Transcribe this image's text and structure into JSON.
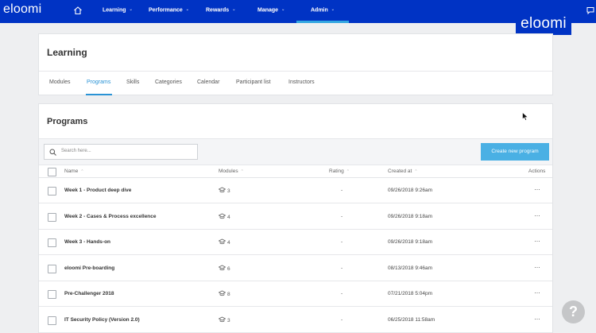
{
  "header": {
    "logo": "eloomi",
    "nav": [
      {
        "label": "Learning"
      },
      {
        "label": "Performance"
      },
      {
        "label": "Rewards"
      },
      {
        "label": "Manage"
      },
      {
        "label": "Admin",
        "active": true
      }
    ],
    "caret": "⌄"
  },
  "brand": {
    "logo": "eloomi"
  },
  "learning": {
    "title": "Learning",
    "tabs": [
      {
        "label": "Modules"
      },
      {
        "label": "Programs",
        "active": true
      },
      {
        "label": "Skills"
      },
      {
        "label": "Categories"
      },
      {
        "label": "Calendar"
      },
      {
        "label": "Participant list"
      },
      {
        "label": "Instructors"
      }
    ]
  },
  "programs": {
    "title": "Programs",
    "search_placeholder": "Search here...",
    "create_label": "Create new program",
    "columns": {
      "name": "Name",
      "modules": "Modules",
      "rating": "Rating",
      "created": "Created at",
      "actions": "Actions"
    },
    "sort_glyph": "⌃",
    "rows": [
      {
        "name": "Week 1 - Product deep dive",
        "modules": "3",
        "rating": "-",
        "created": "09/26/2018 9:26am",
        "actions": "···"
      },
      {
        "name": "Week 2 - Cases & Process excellence",
        "modules": "4",
        "rating": "-",
        "created": "09/26/2018 9:18am",
        "actions": "···"
      },
      {
        "name": "Week 3 - Hands-on",
        "modules": "4",
        "rating": "-",
        "created": "09/26/2018 9:18am",
        "actions": "···"
      },
      {
        "name": "eloomi Pre-boarding",
        "modules": "6",
        "rating": "-",
        "created": "08/13/2018 9:46am",
        "actions": "···"
      },
      {
        "name": "Pre-Challenger 2018",
        "modules": "8",
        "rating": "-",
        "created": "07/21/2018 5:04pm",
        "actions": "···"
      },
      {
        "name": "IT Security Policy (Version 2.0)",
        "modules": "3",
        "rating": "-",
        "created": "06/25/2018 11:58am",
        "actions": "···"
      }
    ]
  },
  "help": {
    "label": "?"
  },
  "colors": {
    "nav_bg": "#0033c4",
    "accent": "#2a93d5",
    "button": "#4ab0e4"
  }
}
